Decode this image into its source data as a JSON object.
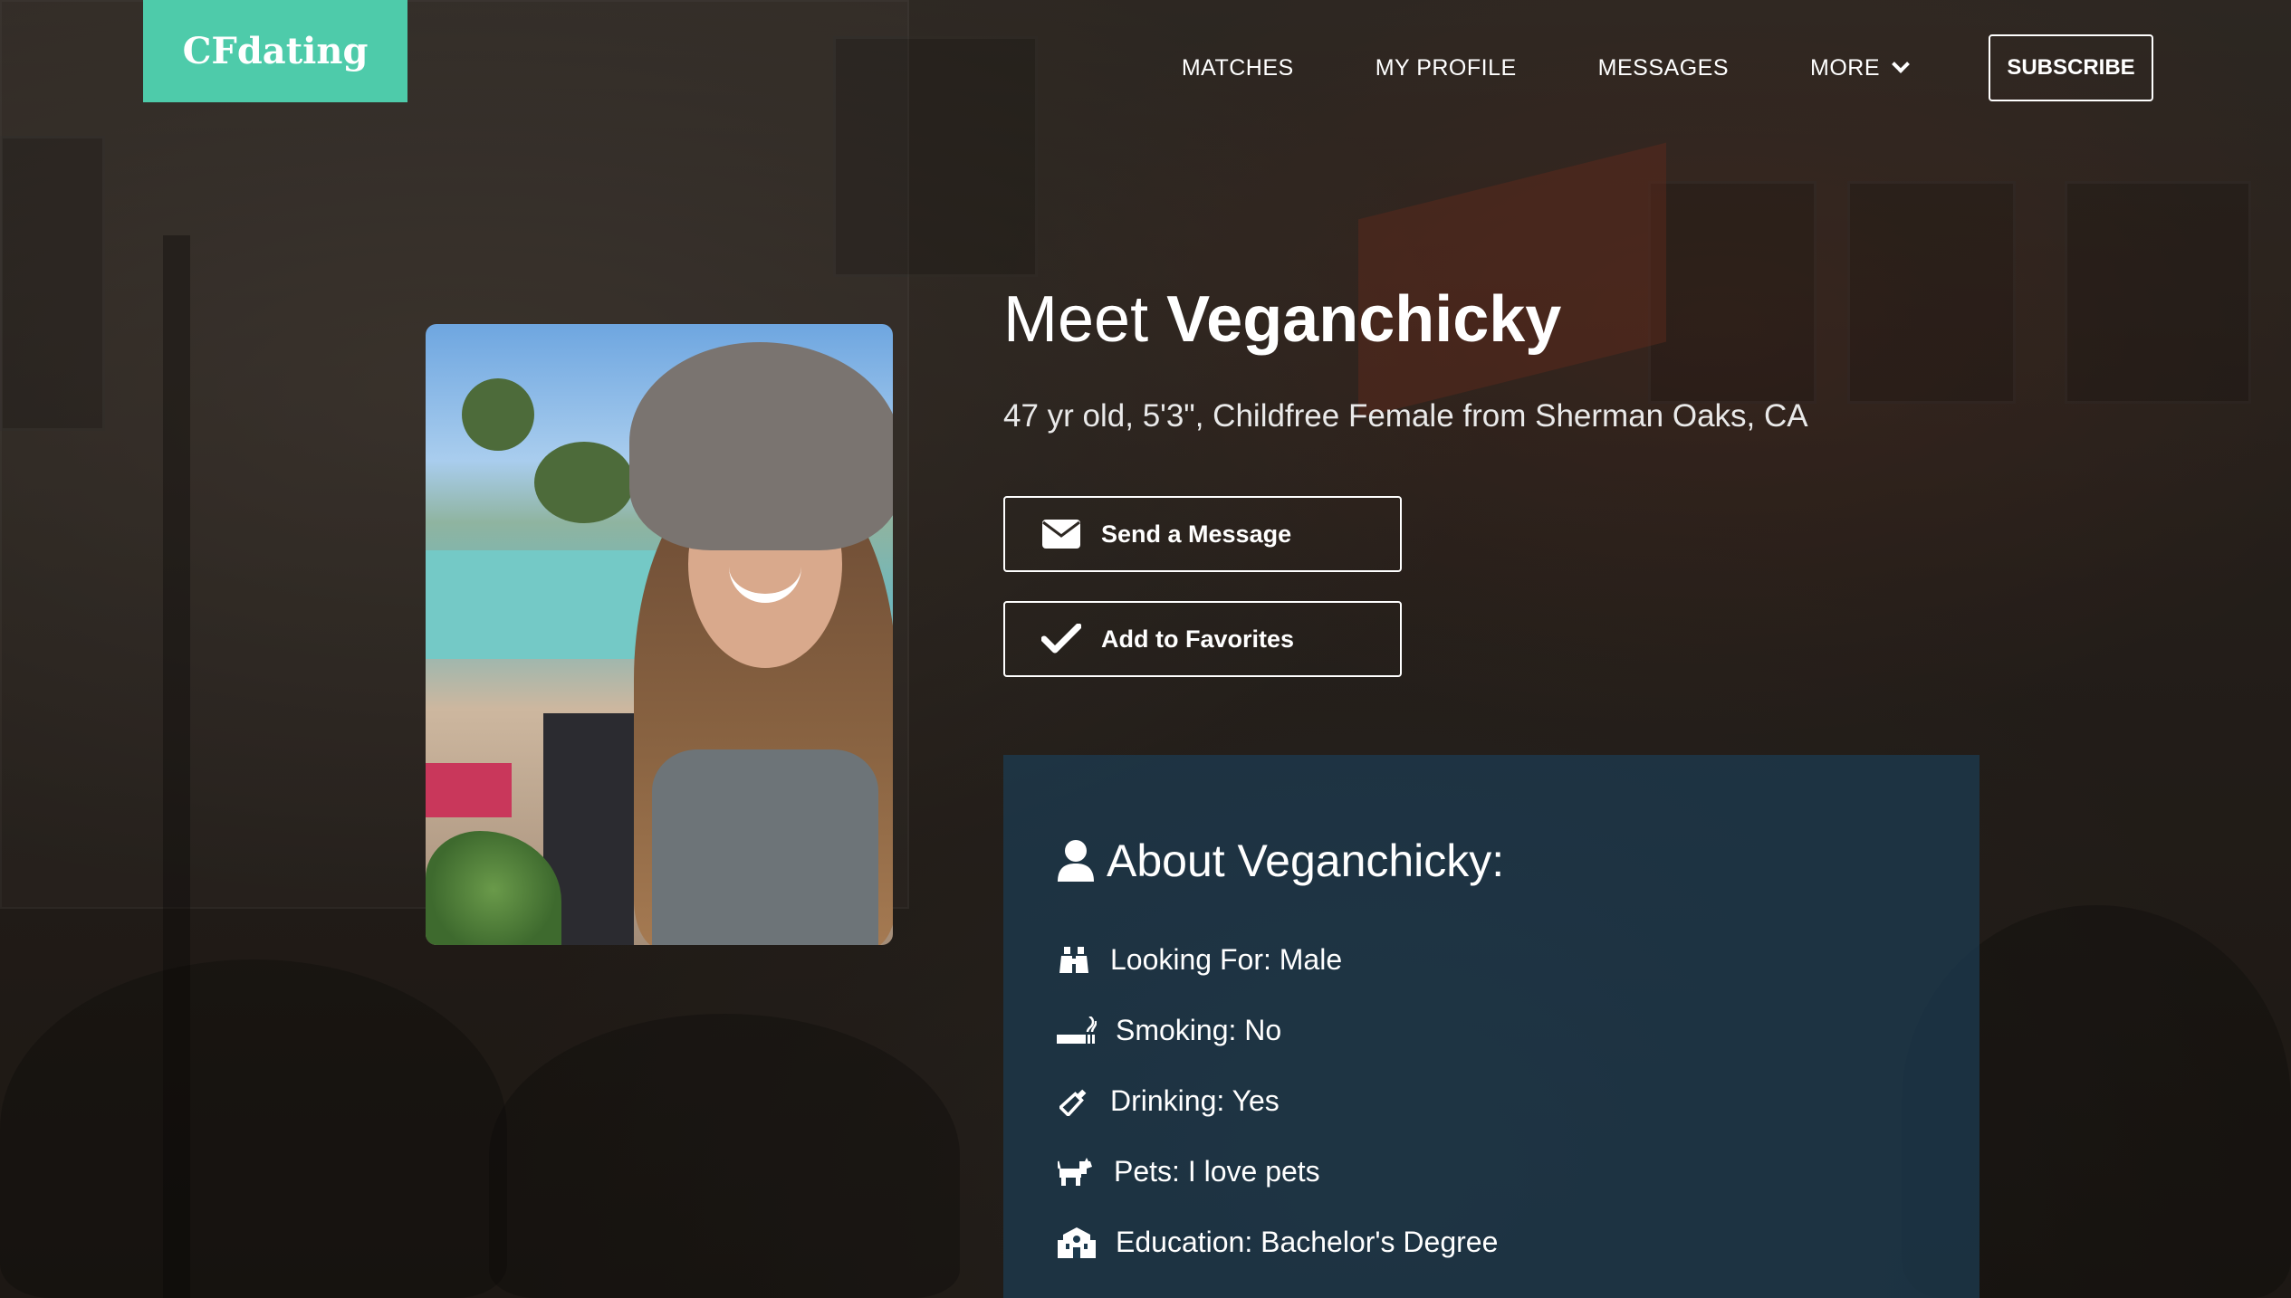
{
  "header": {
    "logo": "CFdating",
    "nav": {
      "matches": "MATCHES",
      "my_profile": "MY PROFILE",
      "messages": "MESSAGES",
      "more": "MORE",
      "subscribe": "SUBSCRIBE"
    }
  },
  "profile": {
    "meet_prefix": "Meet",
    "name": "Veganchicky",
    "summary": "47 yr old, 5'3\", Childfree Female from Sherman Oaks, CA",
    "photo_icon": "profile-photo"
  },
  "actions": {
    "send_message": "Send a Message",
    "add_favorites": "Add to Favorites",
    "send_message_icon": "envelope-icon",
    "add_favorites_icon": "checkmark-icon"
  },
  "about": {
    "title": "About Veganchicky:",
    "title_icon": "user-icon",
    "rows": [
      {
        "icon": "binoculars-icon",
        "text": "Looking For: Male"
      },
      {
        "icon": "smoking-icon",
        "text": "Smoking: No"
      },
      {
        "icon": "wine-bottle-icon",
        "text": "Drinking: Yes"
      },
      {
        "icon": "dog-icon",
        "text": "Pets: I love pets"
      },
      {
        "icon": "school-icon",
        "text": "Education: Bachelor's Degree"
      }
    ]
  },
  "colors": {
    "brand": "#4ecbaa",
    "about_panel": "#1c3a4e"
  }
}
